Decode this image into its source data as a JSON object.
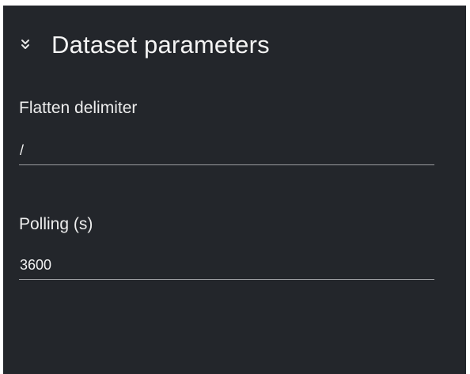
{
  "section": {
    "title": "Dataset parameters",
    "icon": "double-chevron-down-icon",
    "expanded": true
  },
  "fields": [
    {
      "label": "Flatten delimiter",
      "value": "/"
    },
    {
      "label": "Polling (s)",
      "value": "3600"
    }
  ],
  "colors": {
    "panel_background": "#23262b",
    "text": "#f0f0f0",
    "underline": "#9b9da1"
  }
}
